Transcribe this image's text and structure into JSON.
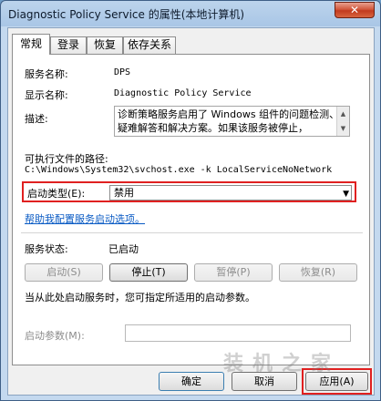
{
  "window": {
    "title": "Diagnostic Policy Service 的属性(本地计算机)",
    "close_label": "✕"
  },
  "tabs": [
    {
      "label": "常规"
    },
    {
      "label": "登录"
    },
    {
      "label": "恢复"
    },
    {
      "label": "依存关系"
    }
  ],
  "general": {
    "service_name_label": "服务名称:",
    "service_name": "DPS",
    "display_name_label": "显示名称:",
    "display_name": "Diagnostic Policy Service",
    "description_label": "描述:",
    "description": "诊断策略服务启用了 Windows 组件的问题检测、疑难解答和解决方案。如果该服务被停止，",
    "exec_path_label": "可执行文件的路径:",
    "exec_path": "C:\\Windows\\System32\\svchost.exe -k LocalServiceNoNetwork",
    "startup_type_label": "启动类型(E):",
    "startup_type": "禁用",
    "help_link": "帮助我配置服务启动选项。",
    "status_label": "服务状态:",
    "status": "已启动",
    "buttons": {
      "start": "启动(S)",
      "stop": "停止(T)",
      "pause": "暂停(P)",
      "resume": "恢复(R)"
    },
    "hint": "当从此处启动服务时，您可指定所适用的启动参数。",
    "start_params_label": "启动参数(M):",
    "start_params_value": ""
  },
  "footer": {
    "ok": "确定",
    "cancel": "取消",
    "apply": "应用(A)"
  },
  "watermark": "装机之家",
  "colors": {
    "highlight_frame": "#e02020",
    "link": "#0a5bc4"
  }
}
